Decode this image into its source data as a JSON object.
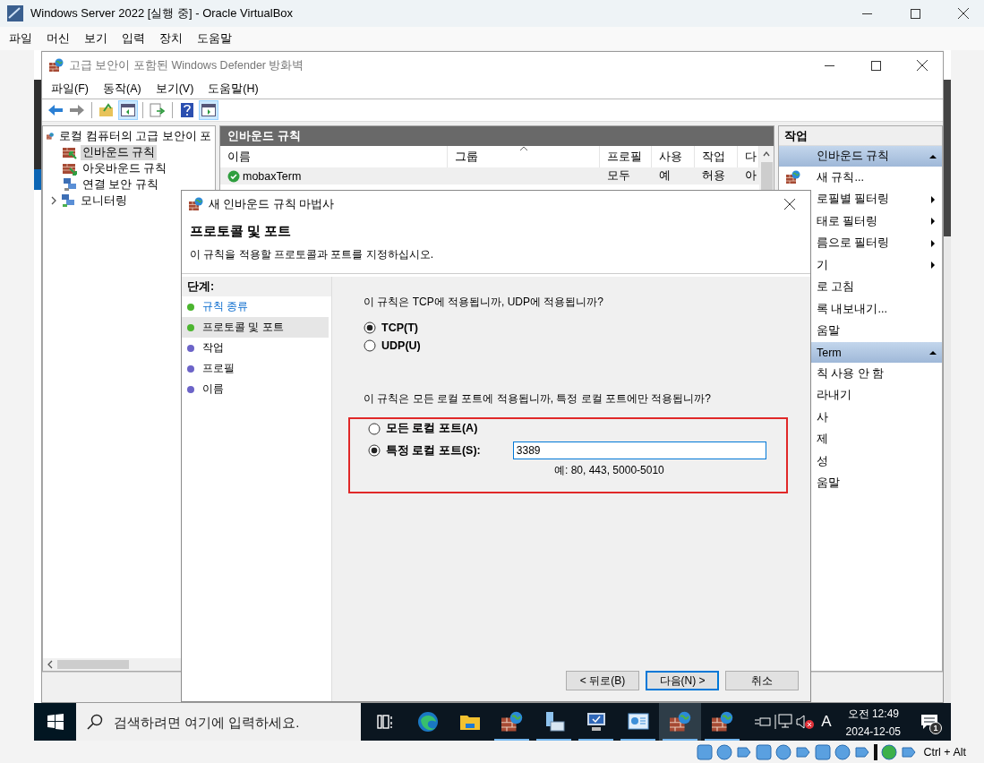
{
  "window": {
    "title": "Windows Server 2022 [실행 중] - Oracle VirtualBox"
  },
  "menu": [
    "파일",
    "머신",
    "보기",
    "입력",
    "장치",
    "도움말"
  ],
  "firewall": {
    "title": "고급 보안이 포함된 Windows Defender 방화벽",
    "menu": [
      "파일(F)",
      "동작(A)",
      "보기(V)",
      "도움말(H)"
    ],
    "toolbar": [
      {
        "kind": "back",
        "on": false
      },
      {
        "kind": "forward",
        "on": false
      },
      {
        "kind": "up",
        "on": false
      },
      {
        "kind": "tree",
        "on": true
      },
      {
        "kind": "export",
        "on": false
      },
      {
        "kind": "help",
        "on": false
      },
      {
        "kind": "actions",
        "on": true
      }
    ],
    "tree": {
      "label": "로컬 컴퓨터의 고급 보안이 포",
      "children": [
        {
          "label": "인바운드 규칙",
          "kind": "inbound",
          "selected": true,
          "expandable": false
        },
        {
          "label": "아웃바운드 규칙",
          "kind": "outbound",
          "selected": false,
          "expandable": false
        },
        {
          "label": "연결 보안 규칙",
          "kind": "connection",
          "selected": false,
          "expandable": false
        },
        {
          "label": "모니터링",
          "kind": "monitor",
          "selected": false,
          "expandable": true
        }
      ]
    },
    "rules": {
      "title": "인바운드 규칙",
      "columns": [
        {
          "label": "이름",
          "sorted": false
        },
        {
          "label": "그룹",
          "sorted": true
        },
        {
          "label": "프로필",
          "sorted": false
        },
        {
          "label": "사용",
          "sorted": false
        },
        {
          "label": "작업",
          "sorted": false
        },
        {
          "label": "다",
          "sorted": false
        }
      ],
      "rows": [
        {
          "cells": [
            "mobaxTerm",
            "",
            "모두",
            "예",
            "허용",
            "아"
          ],
          "enabled": true
        }
      ]
    },
    "actions": {
      "title": "작업",
      "sections": [
        {
          "title": "인바운드 규칙",
          "items": [
            {
              "label": "새 규칙...",
              "kind": "new_rule",
              "submenu": false
            },
            {
              "label": "로필별 필터링",
              "kind": "command",
              "submenu": true
            },
            {
              "label": "태로 필터링",
              "kind": "command",
              "submenu": true
            },
            {
              "label": "름으로 필터링",
              "kind": "command",
              "submenu": true
            },
            {
              "label": "기",
              "kind": "command",
              "submenu": true
            },
            {
              "label": "로 고침",
              "kind": "command",
              "submenu": false
            },
            {
              "label": "록 내보내기...",
              "kind": "command",
              "submenu": false
            },
            {
              "label": "움말",
              "kind": "command",
              "submenu": false
            }
          ]
        },
        {
          "title": "Term",
          "items": [
            {
              "label": "칙 사용 안 함",
              "kind": "command",
              "submenu": false
            },
            {
              "label": "라내기",
              "kind": "command",
              "submenu": false
            },
            {
              "label": "사",
              "kind": "command",
              "submenu": false
            },
            {
              "label": "제",
              "kind": "command",
              "submenu": false
            },
            {
              "label": "성",
              "kind": "command",
              "submenu": false
            },
            {
              "label": "움말",
              "kind": "command",
              "submenu": false
            }
          ]
        }
      ]
    }
  },
  "dialog": {
    "title": "새 인바운드 규칙 마법사",
    "heading": "프로토콜 및 포트",
    "description": "이 규칙을 적용할 프로토콜과 포트를 지정하십시오.",
    "steps_title": "단계:",
    "steps": [
      {
        "label": "규칙 종류",
        "done": true,
        "selected": false
      },
      {
        "label": "프로토콜 및 포트",
        "done": true,
        "selected": true
      },
      {
        "label": "작업",
        "done": false,
        "selected": false
      },
      {
        "label": "프로필",
        "done": false,
        "selected": false
      },
      {
        "label": "이름",
        "done": false,
        "selected": false
      }
    ],
    "protocol_question": "이 규칙은 TCP에 적용됩니까, UDP에 적용됩니까?",
    "protocol_options": [
      {
        "label": "TCP(T)",
        "selected": true
      },
      {
        "label": "UDP(U)",
        "selected": false
      }
    ],
    "port_question": "이 규칙은 모든 로컬 포트에 적용됩니까, 특정 로컬 포트에만 적용됩니까?",
    "port_options": [
      {
        "label": "모든 로컬 포트(A)",
        "selected": false
      },
      {
        "label": "특정 로컬 포트(S):",
        "selected": true
      }
    ],
    "port_field": {
      "value": "3389"
    },
    "port_example": "예: 80, 443, 5000-5010",
    "buttons": [
      {
        "label": "< 뒤로(B)",
        "default": false
      },
      {
        "label": "다음(N) >",
        "default": true
      },
      {
        "label": "취소",
        "default": false
      }
    ]
  },
  "taskbar": {
    "search": {
      "placeholder": "검색하려면 여기에 입력하세요."
    },
    "apps": [
      {
        "kind": "taskview",
        "running": false,
        "active": false
      },
      {
        "kind": "browser",
        "running": false,
        "active": false
      },
      {
        "kind": "folder",
        "running": false,
        "active": false
      },
      {
        "kind": "firewall",
        "running": true,
        "active": false
      },
      {
        "kind": "server",
        "running": true,
        "active": false
      },
      {
        "kind": "computer",
        "running": true,
        "active": false
      },
      {
        "kind": "panel",
        "running": true,
        "active": false
      },
      {
        "kind": "firewall",
        "running": true,
        "active": true
      },
      {
        "kind": "firewall",
        "running": true,
        "active": false
      }
    ],
    "ime": "A",
    "time": "오전 12:49",
    "date": "2024-12-05",
    "notifications": "1"
  },
  "status_bar": {
    "keys": "Ctrl + Alt"
  }
}
